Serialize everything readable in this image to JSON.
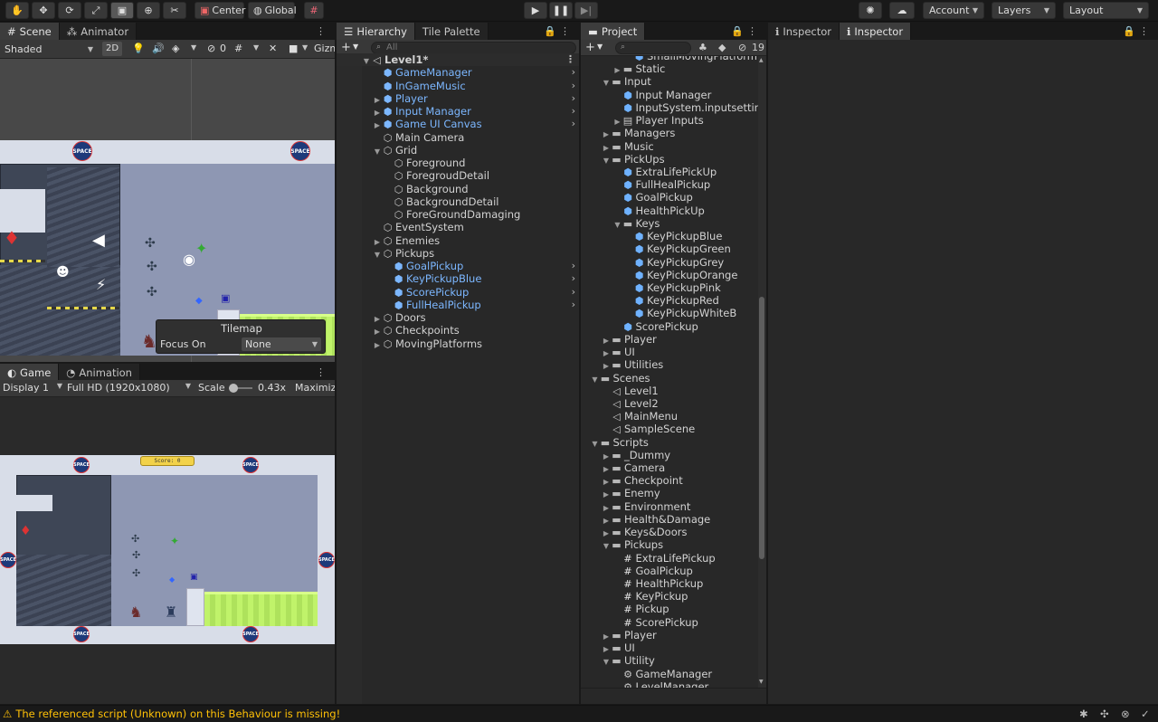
{
  "toolbar": {
    "tools": [
      {
        "name": "hand-tool",
        "glyph": "✋"
      },
      {
        "name": "move-tool",
        "glyph": "✥"
      },
      {
        "name": "rotate-tool",
        "glyph": "⟳"
      },
      {
        "name": "scale-tool",
        "glyph": "⤢"
      },
      {
        "name": "rect-tool",
        "glyph": "▣"
      },
      {
        "name": "transform-tool",
        "glyph": "⊕"
      },
      {
        "name": "custom-tool",
        "glyph": "✂"
      }
    ],
    "pivot_label": "Center",
    "space_label": "Global",
    "account_label": "Account",
    "layers_label": "Layers",
    "layout_label": "Layout"
  },
  "scene": {
    "tab_scene": "Scene",
    "tab_animator": "Animator",
    "shading": "Shaded",
    "mode_2d": "2D",
    "hidden_count": "0",
    "gizmos_label": "Gizmos",
    "overlay_title": "Tilemap",
    "focus_label": "Focus On",
    "focus_value": "None",
    "logo_text": "SPACE"
  },
  "game": {
    "tab_game": "Game",
    "tab_animation": "Animation",
    "display": "Display 1",
    "resolution": "Full HD (1920x1080)",
    "scale_label": "Scale",
    "scale_value": "0.43x",
    "maximize_label": "Maximize",
    "score_text": "Score: 0",
    "logo_text": "SPACE"
  },
  "hierarchy": {
    "tab": "Hierarchy",
    "tab2": "Tile Palette",
    "search_placeholder": "All",
    "items": [
      {
        "label": "Level1*",
        "depth": 0,
        "icon": "scene",
        "arrow": "open",
        "style": "scene"
      },
      {
        "label": "GameManager",
        "depth": 1,
        "icon": "cube",
        "arrow": "",
        "style": "pref",
        "chev": true
      },
      {
        "label": "InGameMusic",
        "depth": 1,
        "icon": "cube",
        "arrow": "",
        "style": "pref",
        "chev": true
      },
      {
        "label": "Player",
        "depth": 1,
        "icon": "cube",
        "arrow": "closed",
        "style": "pref",
        "chev": true
      },
      {
        "label": "Input Manager",
        "depth": 1,
        "icon": "cube",
        "arrow": "closed",
        "style": "pref",
        "chev": true
      },
      {
        "label": "Game UI Canvas",
        "depth": 1,
        "icon": "cube",
        "arrow": "closed",
        "style": "pref",
        "chev": true
      },
      {
        "label": "Main Camera",
        "depth": 1,
        "icon": "gobj",
        "arrow": "",
        "style": "",
        "chev": false
      },
      {
        "label": "Grid",
        "depth": 1,
        "icon": "gobj",
        "arrow": "open",
        "style": "",
        "chev": false
      },
      {
        "label": "Foreground",
        "depth": 2,
        "icon": "gobj",
        "arrow": "",
        "style": "",
        "chev": false
      },
      {
        "label": "ForegroudDetail",
        "depth": 2,
        "icon": "gobj",
        "arrow": "",
        "style": "",
        "chev": false
      },
      {
        "label": "Background",
        "depth": 2,
        "icon": "gobj",
        "arrow": "",
        "style": "",
        "chev": false
      },
      {
        "label": "BackgroundDetail",
        "depth": 2,
        "icon": "gobj",
        "arrow": "",
        "style": "",
        "chev": false
      },
      {
        "label": "ForeGroundDamaging",
        "depth": 2,
        "icon": "gobj",
        "arrow": "",
        "style": "",
        "chev": false
      },
      {
        "label": "EventSystem",
        "depth": 1,
        "icon": "gobj",
        "arrow": "",
        "style": "",
        "chev": false
      },
      {
        "label": "Enemies",
        "depth": 1,
        "icon": "gobj",
        "arrow": "closed",
        "style": "",
        "chev": false
      },
      {
        "label": "Pickups",
        "depth": 1,
        "icon": "gobj",
        "arrow": "open",
        "style": "",
        "chev": false
      },
      {
        "label": "GoalPickup",
        "depth": 2,
        "icon": "cube",
        "arrow": "",
        "style": "pref",
        "chev": true
      },
      {
        "label": "KeyPickupBlue",
        "depth": 2,
        "icon": "cube",
        "arrow": "",
        "style": "pref",
        "chev": true
      },
      {
        "label": "ScorePickup",
        "depth": 2,
        "icon": "cube",
        "arrow": "",
        "style": "pref",
        "chev": true
      },
      {
        "label": "FullHealPickup",
        "depth": 2,
        "icon": "cube",
        "arrow": "",
        "style": "pref",
        "chev": true
      },
      {
        "label": "Doors",
        "depth": 1,
        "icon": "gobj",
        "arrow": "closed",
        "style": "",
        "chev": false
      },
      {
        "label": "Checkpoints",
        "depth": 1,
        "icon": "gobj",
        "arrow": "closed",
        "style": "",
        "chev": false
      },
      {
        "label": "MovingPlatforms",
        "depth": 1,
        "icon": "gobj",
        "arrow": "closed",
        "style": "",
        "chev": false
      }
    ]
  },
  "project": {
    "tab": "Project",
    "hidden_count": "19",
    "items": [
      {
        "label": "SmallMovingPlatform",
        "depth": 4,
        "icon": "cube",
        "arrow": ""
      },
      {
        "label": "Static",
        "depth": 3,
        "icon": "folder",
        "arrow": "closed"
      },
      {
        "label": "Input",
        "depth": 2,
        "icon": "folder",
        "arrow": "open"
      },
      {
        "label": "Input Manager",
        "depth": 3,
        "icon": "cube",
        "arrow": ""
      },
      {
        "label": "InputSystem.inputsettings",
        "depth": 3,
        "icon": "cube",
        "arrow": ""
      },
      {
        "label": "Player Inputs",
        "depth": 3,
        "icon": "asset",
        "arrow": "closed"
      },
      {
        "label": "Managers",
        "depth": 2,
        "icon": "folder",
        "arrow": "closed"
      },
      {
        "label": "Music",
        "depth": 2,
        "icon": "folder",
        "arrow": "closed"
      },
      {
        "label": "PickUps",
        "depth": 2,
        "icon": "folder",
        "arrow": "open"
      },
      {
        "label": "ExtraLifePickUp",
        "depth": 3,
        "icon": "cube",
        "arrow": ""
      },
      {
        "label": "FullHealPickup",
        "depth": 3,
        "icon": "cube",
        "arrow": ""
      },
      {
        "label": "GoalPickup",
        "depth": 3,
        "icon": "cube",
        "arrow": ""
      },
      {
        "label": "HealthPickUp",
        "depth": 3,
        "icon": "cube",
        "arrow": ""
      },
      {
        "label": "Keys",
        "depth": 3,
        "icon": "folder",
        "arrow": "open"
      },
      {
        "label": "KeyPickupBlue",
        "depth": 4,
        "icon": "cube",
        "arrow": ""
      },
      {
        "label": "KeyPickupGreen",
        "depth": 4,
        "icon": "cube",
        "arrow": ""
      },
      {
        "label": "KeyPickupGrey",
        "depth": 4,
        "icon": "cube",
        "arrow": ""
      },
      {
        "label": "KeyPickupOrange",
        "depth": 4,
        "icon": "cube",
        "arrow": ""
      },
      {
        "label": "KeyPickupPink",
        "depth": 4,
        "icon": "cube",
        "arrow": ""
      },
      {
        "label": "KeyPickupRed",
        "depth": 4,
        "icon": "cube",
        "arrow": ""
      },
      {
        "label": "KeyPickupWhiteB",
        "depth": 4,
        "icon": "cube",
        "arrow": ""
      },
      {
        "label": "ScorePickup",
        "depth": 3,
        "icon": "cube",
        "arrow": ""
      },
      {
        "label": "Player",
        "depth": 2,
        "icon": "folder",
        "arrow": "closed"
      },
      {
        "label": "UI",
        "depth": 2,
        "icon": "folder",
        "arrow": "closed"
      },
      {
        "label": "Utilities",
        "depth": 2,
        "icon": "folder",
        "arrow": "closed"
      },
      {
        "label": "Scenes",
        "depth": 1,
        "icon": "folder",
        "arrow": "open"
      },
      {
        "label": "Level1",
        "depth": 2,
        "icon": "scene",
        "arrow": ""
      },
      {
        "label": "Level2",
        "depth": 2,
        "icon": "scene",
        "arrow": ""
      },
      {
        "label": "MainMenu",
        "depth": 2,
        "icon": "scene",
        "arrow": ""
      },
      {
        "label": "SampleScene",
        "depth": 2,
        "icon": "scene",
        "arrow": ""
      },
      {
        "label": "Scripts",
        "depth": 1,
        "icon": "folder",
        "arrow": "open"
      },
      {
        "label": "_Dummy",
        "depth": 2,
        "icon": "folder",
        "arrow": "closed"
      },
      {
        "label": "Camera",
        "depth": 2,
        "icon": "folder",
        "arrow": "closed"
      },
      {
        "label": "Checkpoint",
        "depth": 2,
        "icon": "folder",
        "arrow": "closed"
      },
      {
        "label": "Enemy",
        "depth": 2,
        "icon": "folder",
        "arrow": "closed"
      },
      {
        "label": "Environment",
        "depth": 2,
        "icon": "folder",
        "arrow": "closed"
      },
      {
        "label": "Health&Damage",
        "depth": 2,
        "icon": "folder",
        "arrow": "closed"
      },
      {
        "label": "Keys&Doors",
        "depth": 2,
        "icon": "folder",
        "arrow": "closed"
      },
      {
        "label": "Pickups",
        "depth": 2,
        "icon": "folder",
        "arrow": "open"
      },
      {
        "label": "ExtraLifePickup",
        "depth": 3,
        "icon": "script",
        "arrow": ""
      },
      {
        "label": "GoalPickup",
        "depth": 3,
        "icon": "script",
        "arrow": ""
      },
      {
        "label": "HealthPickup",
        "depth": 3,
        "icon": "script",
        "arrow": ""
      },
      {
        "label": "KeyPickup",
        "depth": 3,
        "icon": "script",
        "arrow": ""
      },
      {
        "label": "Pickup",
        "depth": 3,
        "icon": "script",
        "arrow": ""
      },
      {
        "label": "ScorePickup",
        "depth": 3,
        "icon": "script",
        "arrow": ""
      },
      {
        "label": "Player",
        "depth": 2,
        "icon": "folder",
        "arrow": "closed"
      },
      {
        "label": "UI",
        "depth": 2,
        "icon": "folder",
        "arrow": "closed"
      },
      {
        "label": "Utility",
        "depth": 2,
        "icon": "folder",
        "arrow": "open"
      },
      {
        "label": "GameManager",
        "depth": 3,
        "icon": "gear",
        "arrow": ""
      },
      {
        "label": "LevelManager",
        "depth": 3,
        "icon": "gear",
        "arrow": ""
      }
    ]
  },
  "inspector": {
    "tab1": "Inspector",
    "tab2": "Inspector"
  },
  "status": {
    "message": "The referenced script (Unknown) on this Behaviour is missing!"
  }
}
